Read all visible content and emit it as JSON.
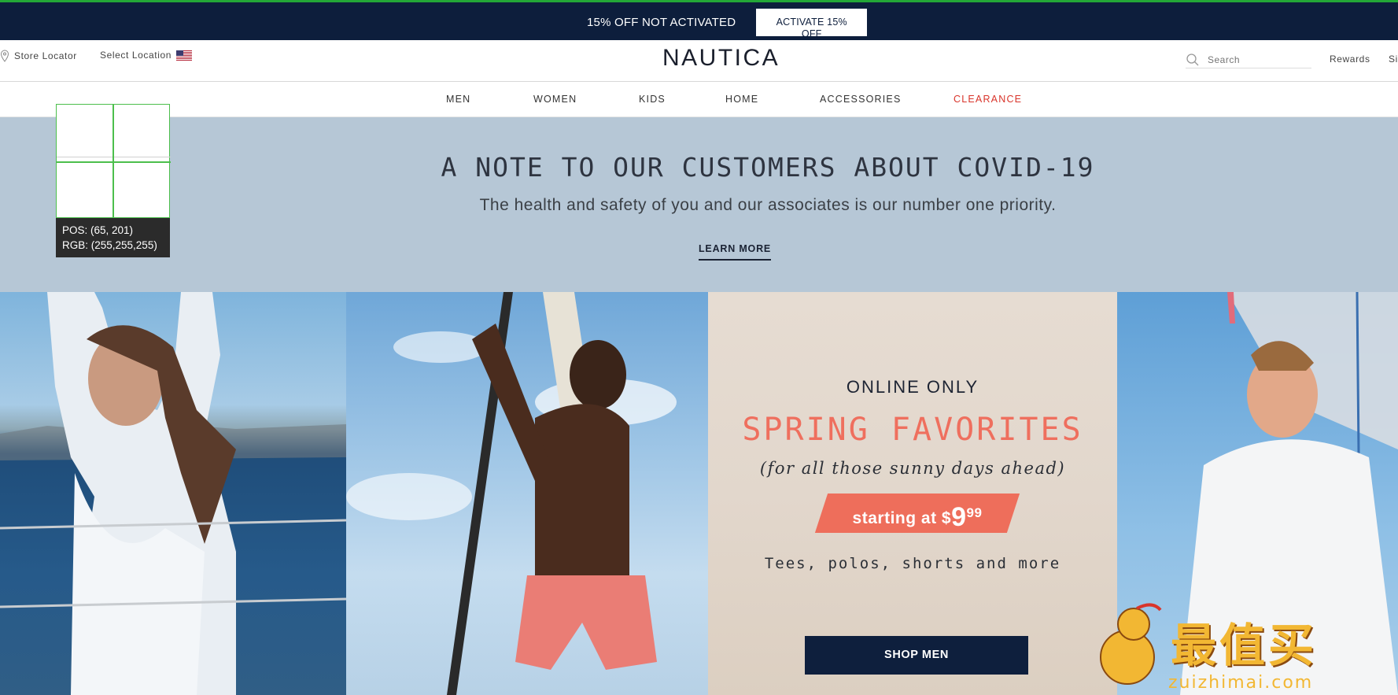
{
  "promo": {
    "status_text": "15% OFF NOT ACTIVATED",
    "activate_label": "ACTIVATE 15% OFF"
  },
  "header": {
    "store_locator": "Store Locator",
    "select_location": "Select Location",
    "logo": "NAUTICA",
    "search_placeholder": "Search",
    "rewards": "Rewards",
    "sign_in": "Si"
  },
  "nav": {
    "items": [
      {
        "label": "MEN"
      },
      {
        "label": "WOMEN"
      },
      {
        "label": "KIDS"
      },
      {
        "label": "HOME"
      },
      {
        "label": "ACCESSORIES"
      },
      {
        "label": "CLEARANCE"
      }
    ],
    "clearance_color": "#d9352b"
  },
  "covid": {
    "title": "A NOTE TO OUR CUSTOMERS ABOUT COVID-19",
    "subtitle": "The health and safety of you and our associates is our number one priority.",
    "learn_more": "LEARN MORE"
  },
  "inspector": {
    "pos": "POS: (65, 201)",
    "rgb": "RGB: (255,255,255)"
  },
  "promo_panel": {
    "online_only": "ONLINE ONLY",
    "headline": "SPRING FAVORITES",
    "tagline": "(for all those sunny days ahead)",
    "price_prefix": "starting at ",
    "price_dollar": "$",
    "price_whole": "9",
    "price_cents": "99",
    "items": "Tees, polos, shorts and more",
    "cta": "SHOP MEN",
    "accent_color": "#ee6e5b"
  },
  "watermark": {
    "text": "最值买",
    "sub": "zuizhimai.com"
  },
  "colors": {
    "navy": "#0d1e3c",
    "banner": "#b6c7d6",
    "green_line": "#23a737"
  }
}
